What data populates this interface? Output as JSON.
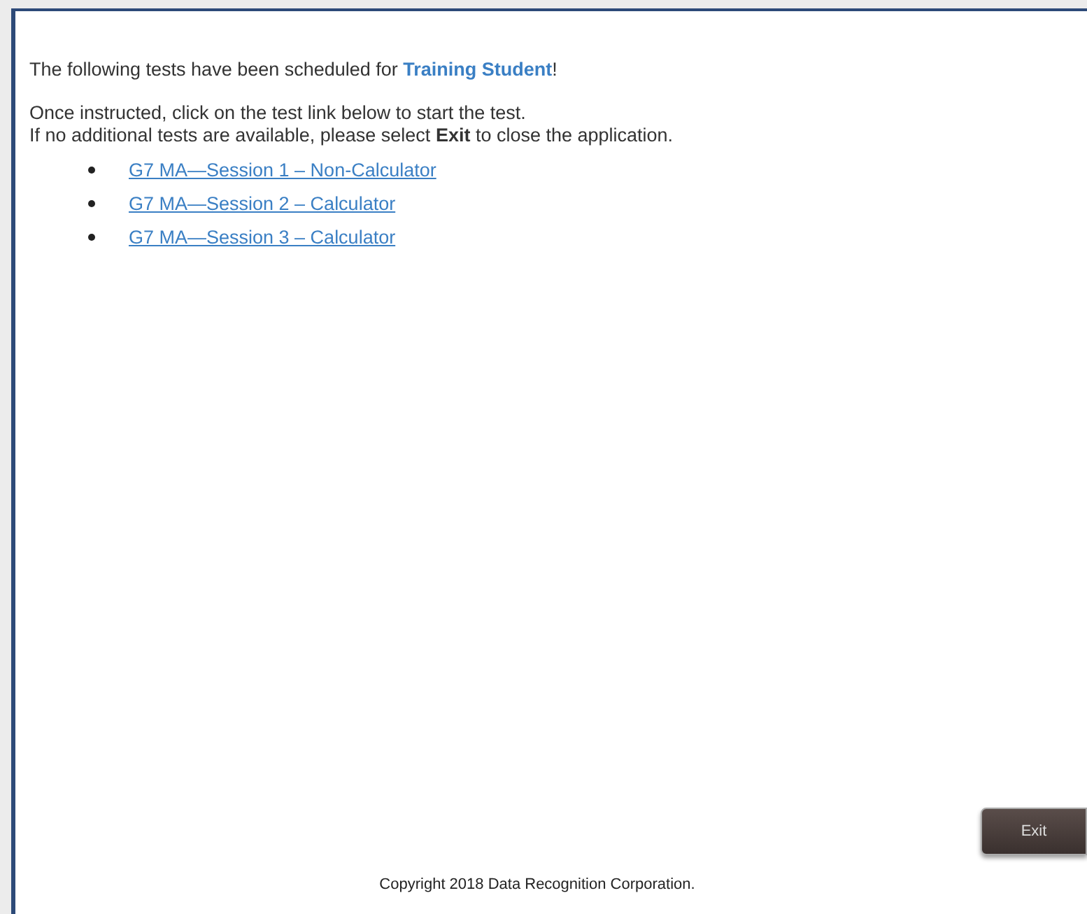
{
  "greeting": {
    "prefix": "The following tests have been scheduled for ",
    "name": "Training Student",
    "suffix": "!"
  },
  "instructions": [
    "Once instructed, click on the test link below to start the test.",
    "If no additional tests are available, please select **Exit** to close the application."
  ],
  "tests": [
    "G7 MA—Session 1 – Non-Calculator",
    "G7 MA—Session 2 – Calculator",
    "G7 MA—Session 3 – Calculator"
  ],
  "exit_button": "Exit",
  "copyright": "Copyright 2018 Data Recognition Corporation."
}
